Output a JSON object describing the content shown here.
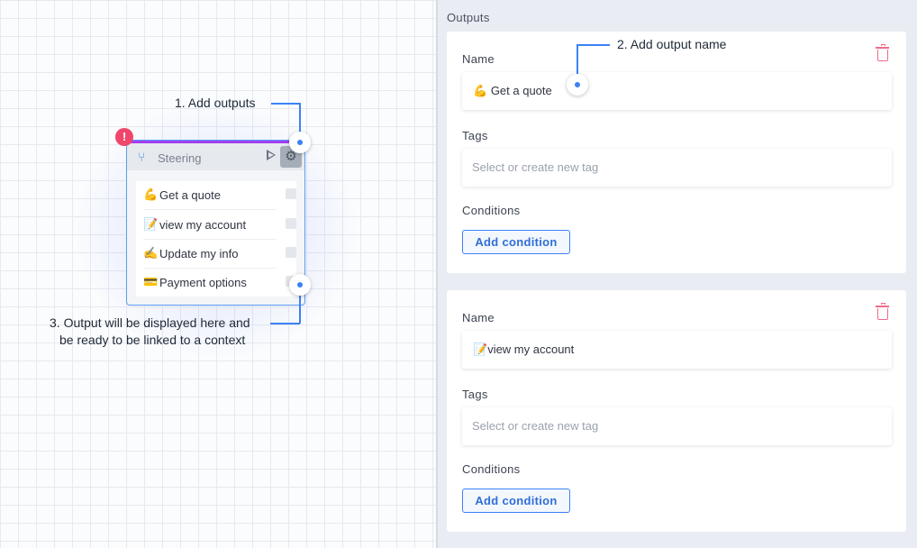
{
  "canvas": {
    "node": {
      "title": "Steering",
      "rows": [
        {
          "emoji": "💪",
          "label": "Get a quote"
        },
        {
          "emoji": "📝",
          "label": "view my account"
        },
        {
          "emoji": "✍️",
          "label": "Update my info"
        },
        {
          "emoji": "💳",
          "label": "Payment options"
        }
      ]
    },
    "warning_glyph": "!",
    "callouts": {
      "add_outputs": "1. Add outputs",
      "output_display_line1": "3. Output will be displayed here and",
      "output_display_line2": "be ready to be linked to a context"
    }
  },
  "panel": {
    "title": "Outputs",
    "callout_add_name": "2. Add output name",
    "outputs": [
      {
        "name_label": "Name",
        "name_emoji": "💪",
        "name_value": "Get a quote",
        "tags_label": "Tags",
        "tags_placeholder": "Select or create new tag",
        "conditions_label": "Conditions",
        "add_condition": "Add condition"
      },
      {
        "name_label": "Name",
        "name_emoji": "📝",
        "name_value": "view my account",
        "tags_label": "Tags",
        "tags_placeholder": "Select or create new tag",
        "conditions_label": "Conditions",
        "add_condition": "Add condition"
      }
    ]
  },
  "colors": {
    "accent": "#3b82f6",
    "node_topline": "#a040f0",
    "warning": "#f0466b",
    "delete": "#f06b8a"
  }
}
